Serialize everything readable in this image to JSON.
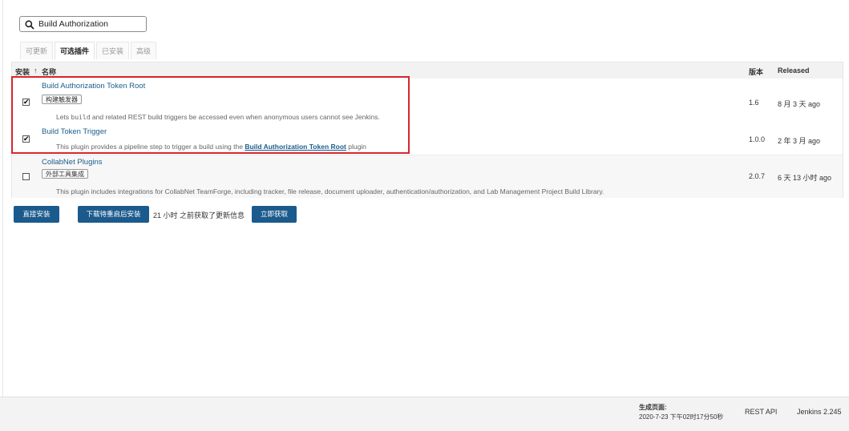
{
  "search": {
    "value": "Build Authorization"
  },
  "tabs": [
    "可更新",
    "可选插件",
    "已安装",
    "高级"
  ],
  "table": {
    "headers": {
      "install": "安装",
      "sort_arrow": "↑",
      "name": "名称",
      "version": "版本",
      "released": "Released"
    },
    "rows": [
      {
        "name": "Build Authorization Token Root",
        "tag": "构建触发器",
        "desc_pre": "Lets ",
        "desc_code": "build",
        "desc_post": " and related REST build triggers be accessed even when anonymous users cannot see Jenkins.",
        "version": "1.6",
        "released": "8 月 3 天 ago",
        "checked": true
      },
      {
        "name": "Build Token Trigger",
        "desc_pre": "This plugin provides a pipeline step to trigger a build using the ",
        "desc_link": "Build Authorization Token Root",
        "desc_post": " plugin",
        "version": "1.0.0",
        "released": "2 年 3 月 ago",
        "checked": true
      },
      {
        "name": "CollabNet Plugins",
        "tag": "外部工具集成",
        "desc": "This plugin includes integrations for CollabNet TeamForge, including tracker, file release, document uploader, authentication/authorization, and Lab Management Project Build Library.",
        "version": "2.0.7",
        "released": "6 天 13 小时 ago",
        "checked": false
      }
    ]
  },
  "actions": {
    "install_now": "直接安装",
    "download_restart": "下载待重启后安装",
    "update_info": "21 小时 之前获取了更新信息",
    "check_now": "立即获取"
  },
  "footer": {
    "generated_label": "生成页面:",
    "generated_time": "2020-7-23 下午02时17分50秒",
    "rest_api": "REST API",
    "version": "Jenkins 2.245"
  },
  "colors": {
    "accent": "#1b5a8c",
    "highlight_box": "#d9262c",
    "link": "#1a5d8c"
  }
}
